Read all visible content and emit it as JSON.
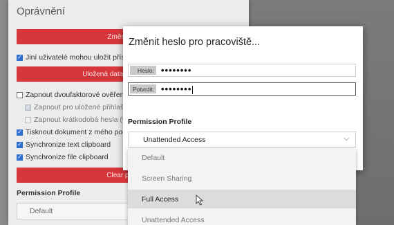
{
  "background": {
    "title": "Oprávnění",
    "change_password_button": "Změnit heslo",
    "allow_save_access": "Jiní uživatelé mohou uložit přístup",
    "saved_access_data_button": "Uložená data přístupu vymaz",
    "two_factor": "Zapnout dvoufaktorové ověření",
    "two_factor_saved": "Zapnout pro uložené přihlašov",
    "two_factor_short": "Zapnout krátkodobá hesla (vzd",
    "print_document": "Tisknout dokument z mého počítač",
    "sync_text_clipboard": "Synchronize text clipboard",
    "sync_file_clipboard": "Synchronize file clipboard",
    "clear_previous_button": "Clear previou",
    "permission_profile_label": "Permission Profile",
    "permission_profile_value": "Default"
  },
  "dialog": {
    "title": "Změnit heslo pro pracoviště...",
    "password_label": "Heslo:",
    "password_value": "••••••••",
    "confirm_label": "Potvrdit:",
    "confirm_value": "••••••••",
    "permission_profile_label": "Permission Profile",
    "selected_profile": "Unattended Access"
  },
  "dropdown": {
    "options": [
      "Default",
      "Screen Sharing",
      "Full Access",
      "Unattended Access"
    ],
    "highlighted": "Full Access"
  },
  "colors": {
    "accent_red": "#d7373c",
    "checkbox_blue": "#2f6fd1"
  }
}
